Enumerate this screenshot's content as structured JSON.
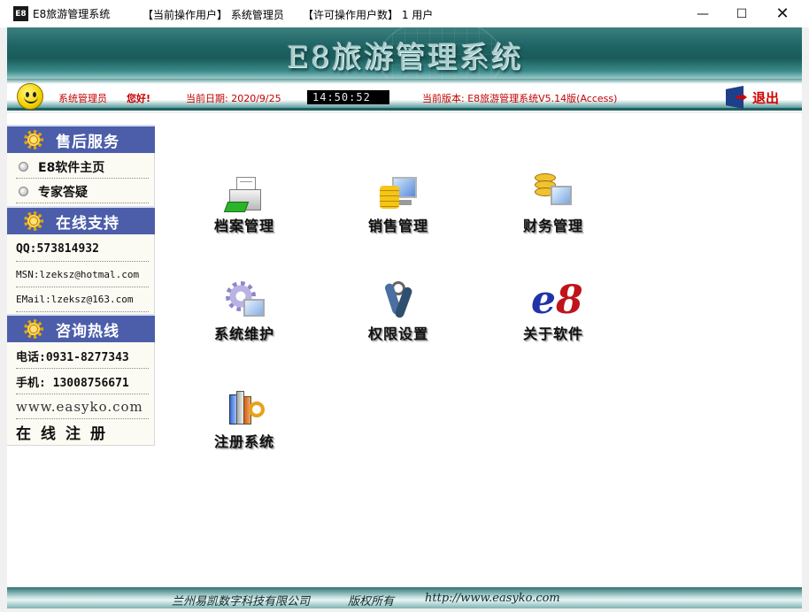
{
  "window": {
    "app_icon_text": "E8",
    "title": "E8旅游管理系统",
    "current_user_label": "【当前操作用户】 系统管理员",
    "license_label": "【许可操作用户数】 1 用户",
    "minimize_glyph": "—",
    "maximize_glyph": "☐",
    "close_glyph": "✕"
  },
  "banner": {
    "title": "E8旅游管理系统"
  },
  "infobar": {
    "user": "系统管理员",
    "greeting": "您好!",
    "date_text": "当前日期: 2020/9/25",
    "clock": "14:50:52",
    "version": "当前版本: E8旅游管理系统V5.14版(Access)",
    "exit_label": "退出"
  },
  "sidebar": {
    "after_sales": {
      "title": "售后服务",
      "links": [
        "E8软件主页",
        "专家答疑"
      ]
    },
    "online_support": {
      "title": "在线支持",
      "qq": "QQ:573814932",
      "msn": "MSN:lzeksz@hotmal.com",
      "email": "EMail:lzeksz@163.com"
    },
    "hotline": {
      "title": "咨询热线",
      "phone": "电话:0931-8277343",
      "mobile": "手机: 13008756671",
      "website": "www.easyko.com",
      "register": "在线注册"
    }
  },
  "tiles": [
    {
      "label": "档案管理",
      "icon": "archive-icon"
    },
    {
      "label": "销售管理",
      "icon": "sales-icon"
    },
    {
      "label": "财务管理",
      "icon": "finance-icon"
    },
    {
      "label": "系统维护",
      "icon": "maintenance-icon"
    },
    {
      "label": "权限设置",
      "icon": "permission-key-icon"
    },
    {
      "label": "关于软件",
      "icon": "e8-logo-icon"
    },
    {
      "label": "注册系统",
      "icon": "register-books-key-icon"
    }
  ],
  "footer": {
    "company": "兰州易凯数字科技有限公司",
    "copyright": "版权所有",
    "url": "http://www.easyko.com"
  },
  "colors": {
    "banner_teal": "#1f6565",
    "sidebar_header": "#4c5eaa",
    "info_red": "#c40000"
  }
}
